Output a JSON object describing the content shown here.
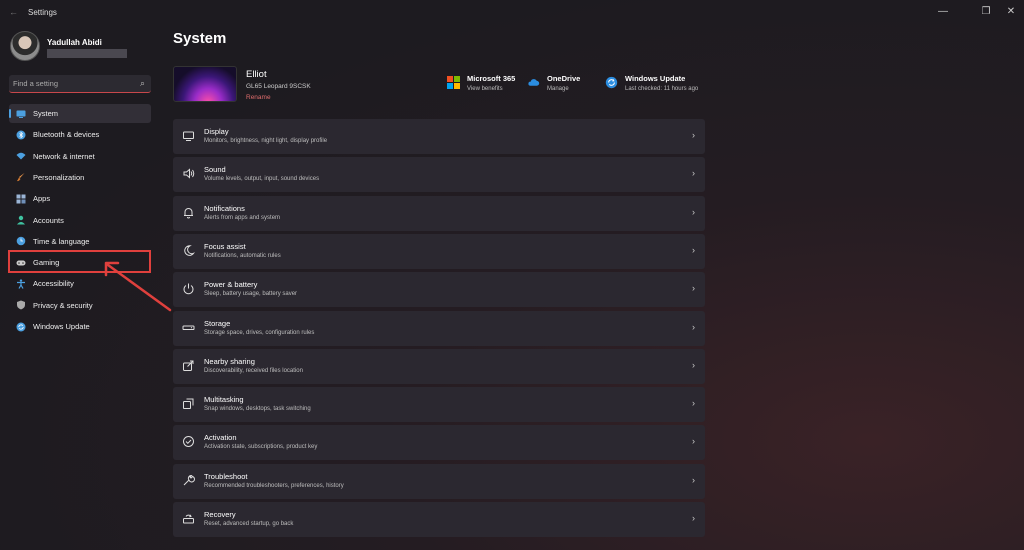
{
  "titlebar": {
    "back_glyph": "←",
    "title": "Settings",
    "minimize": "—",
    "restore": "❐",
    "close": "✕"
  },
  "user": {
    "name": "Yadullah Abidi"
  },
  "search": {
    "placeholder": "Find a setting"
  },
  "sidebar": {
    "items": [
      {
        "label": "System",
        "icon": "monitor-icon",
        "color": "#4ca0e0",
        "active": true
      },
      {
        "label": "Bluetooth & devices",
        "icon": "bluetooth-icon",
        "color": "#4ca0e0"
      },
      {
        "label": "Network & internet",
        "icon": "wifi-icon",
        "color": "#4ca0e0"
      },
      {
        "label": "Personalization",
        "icon": "brush-icon",
        "color": "#e8954a"
      },
      {
        "label": "Apps",
        "icon": "apps-icon",
        "color": "#9bb5d6"
      },
      {
        "label": "Accounts",
        "icon": "person-icon",
        "color": "#3fc2a0"
      },
      {
        "label": "Time & language",
        "icon": "globe-clock-icon",
        "color": "#4ca0e0"
      },
      {
        "label": "Gaming",
        "icon": "gamepad-icon",
        "color": "#cccccc"
      },
      {
        "label": "Accessibility",
        "icon": "accessibility-icon",
        "color": "#4ca0e0"
      },
      {
        "label": "Privacy & security",
        "icon": "shield-icon",
        "color": "#aaaaaa"
      },
      {
        "label": "Windows Update",
        "icon": "update-icon",
        "color": "#4ca0e0"
      }
    ]
  },
  "page": {
    "title": "System"
  },
  "device": {
    "name": "Elliot",
    "model": "GL65 Leopard 9SCSK",
    "rename": "Rename"
  },
  "quick_links": [
    {
      "title": "Microsoft 365",
      "sub": "View benefits",
      "icon": "microsoft-logo-icon"
    },
    {
      "title": "OneDrive",
      "sub": "Manage",
      "icon": "cloud-icon"
    },
    {
      "title": "Windows Update",
      "sub": "Last checked: 11 hours ago",
      "icon": "sync-icon"
    }
  ],
  "settings": [
    {
      "title": "Display",
      "sub": "Monitors, brightness, night light, display profile",
      "icon": "display-icon"
    },
    {
      "title": "Sound",
      "sub": "Volume levels, output, input, sound devices",
      "icon": "speaker-icon"
    },
    {
      "title": "Notifications",
      "sub": "Alerts from apps and system",
      "icon": "bell-icon"
    },
    {
      "title": "Focus assist",
      "sub": "Notifications, automatic rules",
      "icon": "moon-icon"
    },
    {
      "title": "Power & battery",
      "sub": "Sleep, battery usage, battery saver",
      "icon": "power-icon"
    },
    {
      "title": "Storage",
      "sub": "Storage space, drives, configuration rules",
      "icon": "storage-icon"
    },
    {
      "title": "Nearby sharing",
      "sub": "Discoverability, received files location",
      "icon": "share-icon"
    },
    {
      "title": "Multitasking",
      "sub": "Snap windows, desktops, task switching",
      "icon": "multitask-icon"
    },
    {
      "title": "Activation",
      "sub": "Activation state, subscriptions, product key",
      "icon": "check-circle-icon"
    },
    {
      "title": "Troubleshoot",
      "sub": "Recommended troubleshooters, preferences, history",
      "icon": "wrench-icon"
    },
    {
      "title": "Recovery",
      "sub": "Reset, advanced startup, go back",
      "icon": "recovery-icon"
    }
  ],
  "chevron": "›",
  "colors": {
    "accent": "#4ca0e0",
    "highlight": "#e0403d",
    "row_bg": "#2b2830"
  }
}
